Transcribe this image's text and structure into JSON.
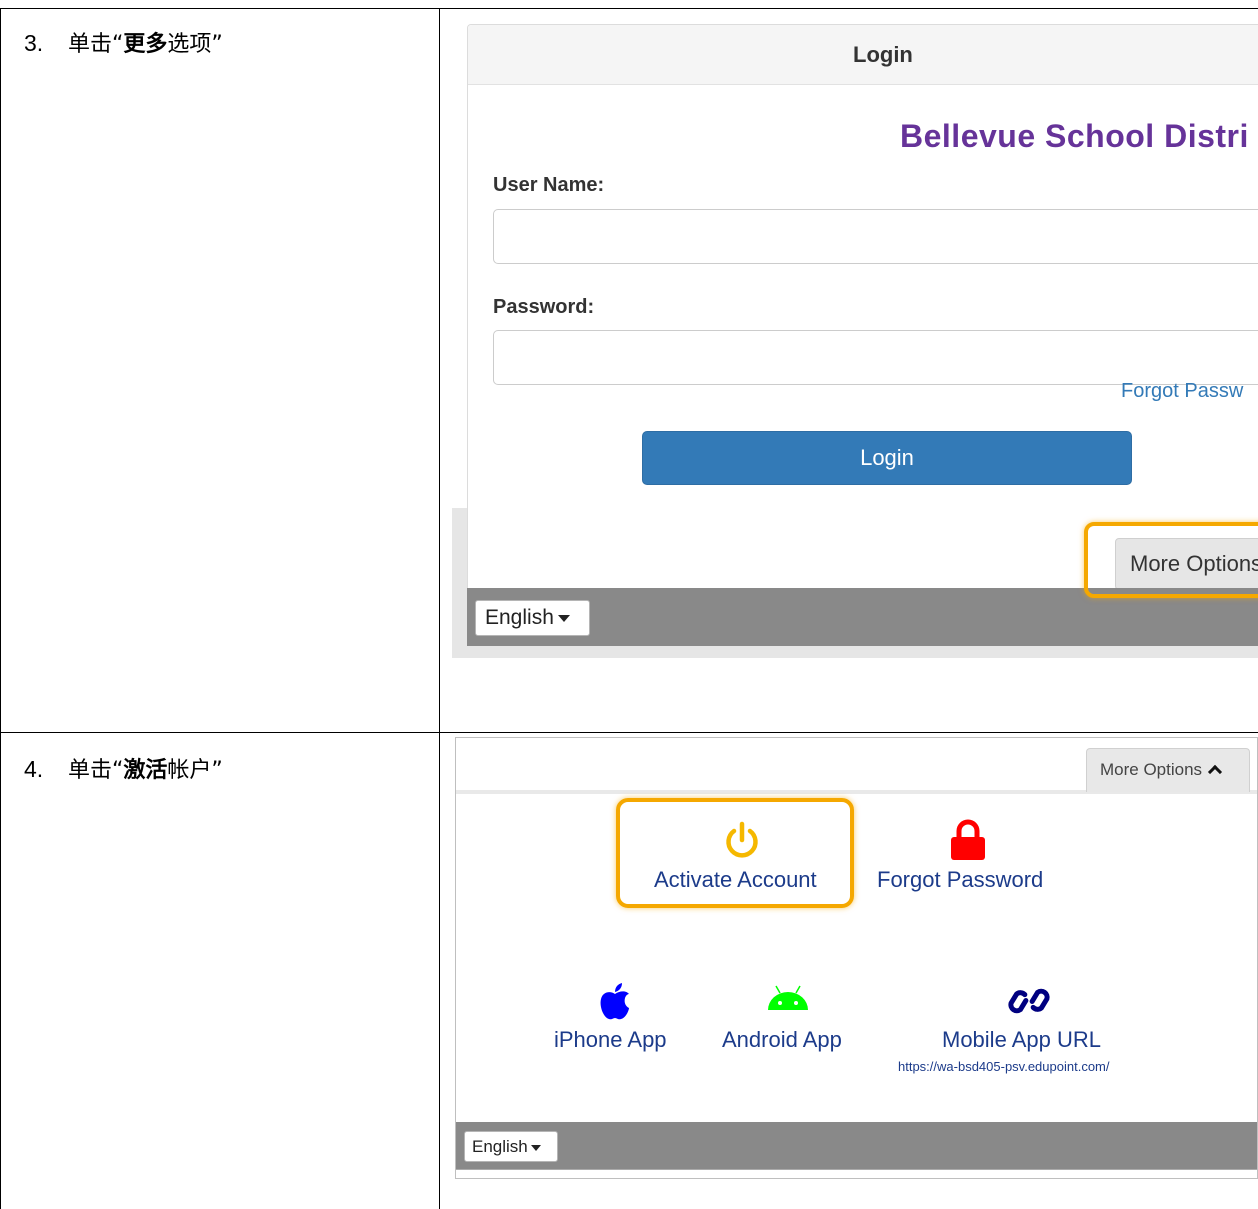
{
  "steps": [
    {
      "number": "3.",
      "prefix": "单击“",
      "bold": "更多",
      "rest": "选项”"
    },
    {
      "number": "4.",
      "prefix": "单击“",
      "bold": "激活",
      "rest": "帐户”"
    }
  ],
  "login_screen": {
    "header_title": "Login",
    "district_name": "Bellevue School Distri",
    "username_label": "User Name:",
    "username_value": "",
    "password_label": "Password:",
    "password_value": "",
    "forgot_link": "Forgot Passw",
    "login_button": "Login",
    "more_options_button": "More Options",
    "language_select": "English",
    "highlight_color": "#f5a800",
    "district_color": "#663399",
    "button_color": "#337ab7"
  },
  "more_options_screen": {
    "more_options_button": "More Options",
    "chevron_icon": "chevron-up-icon",
    "options": [
      {
        "label": "Activate Account",
        "icon": "power-icon",
        "icon_color": "#f5b800"
      },
      {
        "label": "Forgot Password",
        "icon": "lock-icon",
        "icon_color": "#ff0000"
      },
      {
        "label": "iPhone App",
        "icon": "apple-icon",
        "icon_color": "#0000ff"
      },
      {
        "label": "Android App",
        "icon": "android-icon",
        "icon_color": "#00ff00"
      },
      {
        "label": "Mobile App URL",
        "icon": "link-icon",
        "icon_color": "#000080"
      }
    ],
    "mobile_url": "https://wa-bsd405-psv.edupoint.com/",
    "language_select": "English"
  }
}
